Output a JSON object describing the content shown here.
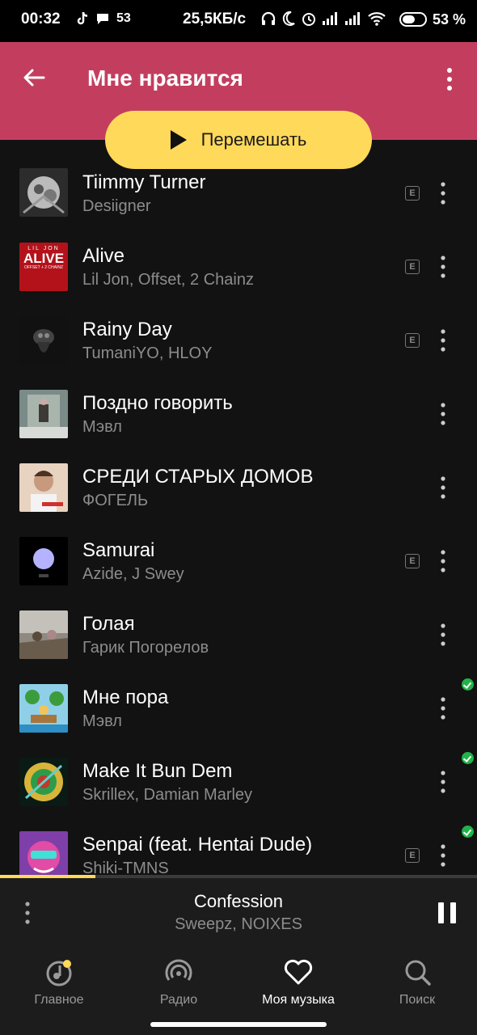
{
  "status_bar": {
    "time": "00:32",
    "notif_count": "53",
    "speed": "25,5КБ/с",
    "battery": "53 %"
  },
  "header": {
    "title": "Мне нравится",
    "shuffle_label": "Перемешать",
    "accent": "#c33e5e",
    "button_color": "#ffd95a"
  },
  "tracks": [
    {
      "title": "Tiimmy Turner",
      "artist": "Desiigner",
      "explicit": true,
      "downloaded": false
    },
    {
      "title": "Alive",
      "artist": "Lil Jon, Offset, 2 Chainz",
      "explicit": true,
      "downloaded": false,
      "cover_top": "LIL JON",
      "cover_main": "ALIVE",
      "cover_sub": "OFFSET + 2 CHAINZ"
    },
    {
      "title": "Rainy Day",
      "artist": "TumaniYO, HLOY",
      "explicit": true,
      "downloaded": false
    },
    {
      "title": "Поздно говорить",
      "artist": "Мэвл",
      "explicit": false,
      "downloaded": false
    },
    {
      "title": "СРЕДИ СТАРЫХ ДОМОВ",
      "artist": "ФОГЕЛЬ",
      "explicit": false,
      "downloaded": false
    },
    {
      "title": "Samurai",
      "artist": "Azide, J Swey",
      "explicit": true,
      "downloaded": false
    },
    {
      "title": "Голая",
      "artist": "Гарик Погорелов",
      "explicit": false,
      "downloaded": false
    },
    {
      "title": "Мне пора",
      "artist": "Мэвл",
      "explicit": false,
      "downloaded": true
    },
    {
      "title": "Make It Bun Dem",
      "artist": "Skrillex, Damian Marley",
      "explicit": false,
      "downloaded": true
    },
    {
      "title": "Senpai (feat. Hentai Dude)",
      "artist": "Shiki-TMNS",
      "explicit": true,
      "downloaded": true
    }
  ],
  "explicit_badge": "E",
  "player": {
    "title": "Confession",
    "artist": "Sweepz, NOIXES",
    "progress": 0.2
  },
  "nav": [
    {
      "label": "Главное",
      "icon": "home-music-icon",
      "active": false
    },
    {
      "label": "Радио",
      "icon": "radio-icon",
      "active": false
    },
    {
      "label": "Моя музыка",
      "icon": "heart-icon",
      "active": true
    },
    {
      "label": "Поиск",
      "icon": "search-icon",
      "active": false
    }
  ]
}
